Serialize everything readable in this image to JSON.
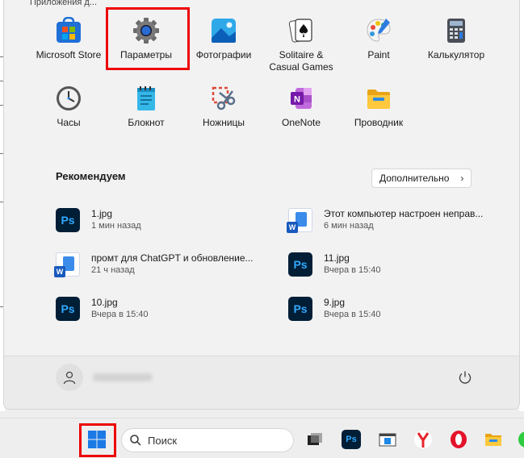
{
  "start_menu": {
    "pinned_header": "Приложения д...",
    "pinned": [
      {
        "label": "Microsoft Store",
        "icon": "microsoft-store-icon"
      },
      {
        "label": "Параметры",
        "icon": "settings-gear-icon"
      },
      {
        "label": "Фотографии",
        "icon": "photos-icon"
      },
      {
        "label": "Solitaire &",
        "label2": "Casual Games",
        "icon": "solitaire-icon"
      },
      {
        "label": "Paint",
        "icon": "paint-icon"
      },
      {
        "label": "Калькулятор",
        "icon": "calculator-icon"
      },
      {
        "label": "Часы",
        "icon": "clock-icon"
      },
      {
        "label": "Блокнот",
        "icon": "notepad-icon"
      },
      {
        "label": "Ножницы",
        "icon": "snipping-tool-icon"
      },
      {
        "label": "OneNote",
        "icon": "onenote-icon"
      },
      {
        "label": "Проводник",
        "icon": "file-explorer-icon"
      }
    ],
    "recommended": {
      "title": "Рекомендуем",
      "more_label": "Дополнительно",
      "items": [
        {
          "name": "1.jpg",
          "time": "1 мин назад",
          "icon": "photoshop-icon"
        },
        {
          "name": "Этот компьютер настроен неправ...",
          "time": "6 мин назад",
          "icon": "word-document-icon"
        },
        {
          "name": "промт для ChatGPT и обновление...",
          "time": "21 ч назад",
          "icon": "word-document-icon"
        },
        {
          "name": "11.jpg",
          "time": "Вчера в 15:40",
          "icon": "photoshop-icon"
        },
        {
          "name": "10.jpg",
          "time": "Вчера в 15:40",
          "icon": "photoshop-icon"
        },
        {
          "name": "9.jpg",
          "time": "Вчера в 15:40",
          "icon": "photoshop-icon"
        }
      ]
    }
  },
  "taskbar": {
    "search_placeholder": "Поиск",
    "ps_label": "Ps"
  },
  "colors": {
    "highlight": "#e00000",
    "accent": "#1e88e5"
  }
}
